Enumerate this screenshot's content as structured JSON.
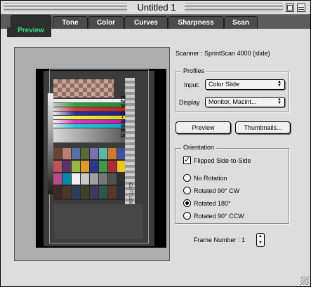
{
  "window": {
    "title": "Untitled 1"
  },
  "tabs": [
    {
      "label": "Preview",
      "active": true
    },
    {
      "label": "Tone",
      "active": false
    },
    {
      "label": "Color",
      "active": false
    },
    {
      "label": "Curves",
      "active": false
    },
    {
      "label": "Sharpness",
      "active": false
    },
    {
      "label": "Scan",
      "active": false
    }
  ],
  "colors": {
    "active_tab_text": "#2fe07f",
    "tab_bar": "#5c5c5c"
  },
  "preview_image": {
    "side_text": "T2X C-R0ES",
    "small_text": "E3 FT 1993 Kodak"
  },
  "scanner": {
    "label": "Scanner : SprintScan 4000 (slide)"
  },
  "profiles": {
    "title": "Profiles",
    "input_label": "Input:",
    "input_value": "Color Slide",
    "display_label": "Display",
    "display_value": "Monitor, Macint..."
  },
  "buttons": {
    "preview": "Preview",
    "thumbnails": "Thumbnails..."
  },
  "orientation": {
    "title": "Orientation",
    "flipped_label": "Flipped Side-to-Side",
    "flipped_checked": true,
    "options": [
      {
        "label": "No Rotation",
        "selected": false
      },
      {
        "label": "Rotated 90° CW",
        "selected": false
      },
      {
        "label": "Rotated 180°",
        "selected": true
      },
      {
        "label": "Rotated 90° CCW",
        "selected": false
      }
    ]
  },
  "frame": {
    "label": "Frame Number :",
    "value": "1"
  }
}
